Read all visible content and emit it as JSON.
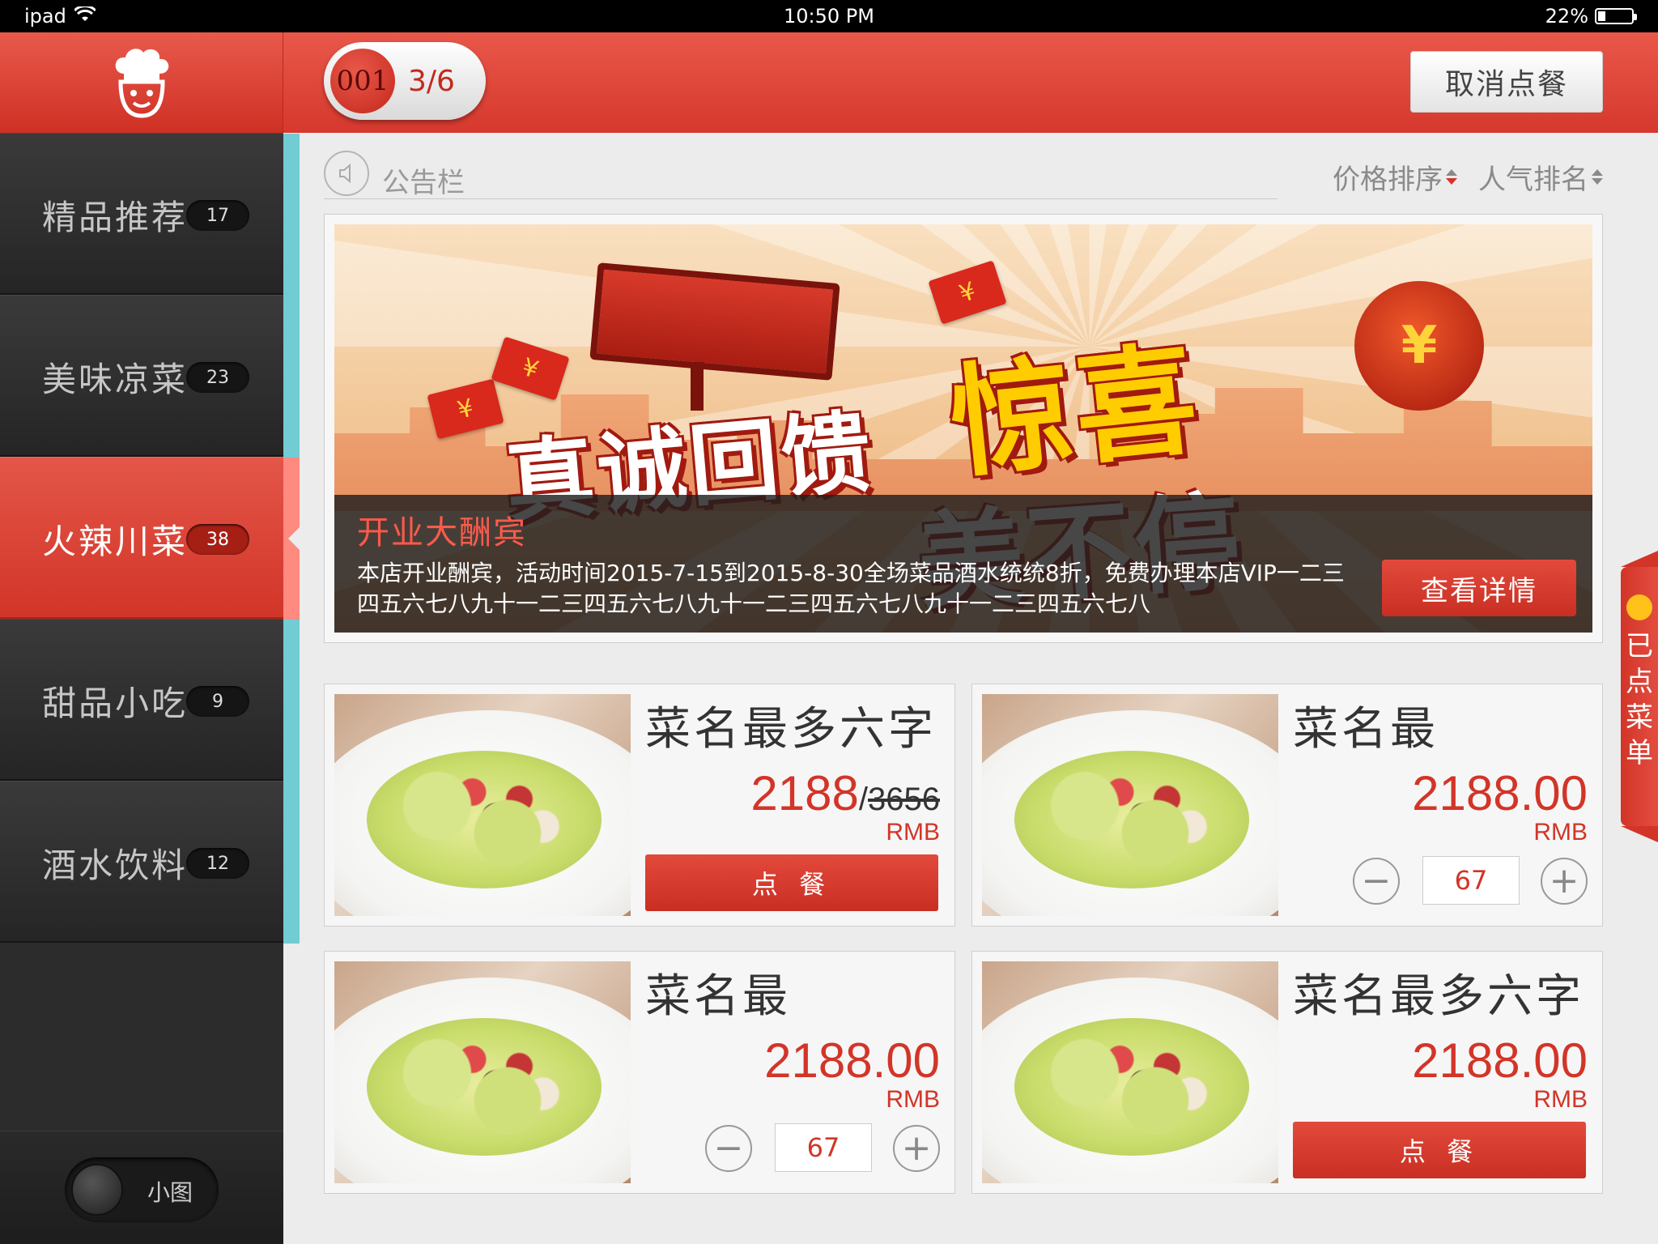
{
  "status_bar": {
    "device": "ipad",
    "time": "10:50 PM",
    "battery": "22%",
    "battery_level": 0.22
  },
  "header": {
    "table_number": "001",
    "table_count": "3/6",
    "cancel_label": "取消点餐"
  },
  "sidebar": {
    "categories": [
      {
        "label": "精品推荐",
        "count": "17"
      },
      {
        "label": "美味凉菜",
        "count": "23"
      },
      {
        "label": "火辣川菜",
        "count": "38"
      },
      {
        "label": "甜品小吃",
        "count": "9"
      },
      {
        "label": "酒水饮料",
        "count": "12"
      }
    ],
    "active_index": 2,
    "toggle_label": "小图"
  },
  "notice": {
    "title": "公告栏"
  },
  "sort": {
    "price": "价格排序",
    "popularity": "人气排名"
  },
  "banner": {
    "promo_line1": "真诚回馈",
    "promo_line2": "惊喜",
    "promo_line3": "美不停",
    "envelope_symbol": "¥",
    "title": "开业大酬宾",
    "description": "本店开业酬宾，活动时间2015-7-15到2015-8-30全场菜品酒水统统8折，免费办理本店VIP一二三四五六七八九十一二三四五六七八九十一二三四五六七八九十一二三四五六七八",
    "details_label": "查看详情"
  },
  "dishes": [
    {
      "name": "菜名最多六字",
      "price": "2188",
      "original_price": "3656",
      "currency": "RMB",
      "action": "点 餐"
    },
    {
      "name": "菜名最",
      "price": "2188.00",
      "currency": "RMB",
      "quantity": "67"
    },
    {
      "name": "菜名最",
      "price": "2188.00",
      "currency": "RMB",
      "quantity": "67"
    },
    {
      "name": "菜名最多六字",
      "price": "2188.00",
      "currency": "RMB",
      "action": "点 餐"
    }
  ],
  "stepper": {
    "minus": "−",
    "plus": "+"
  },
  "drawer": {
    "label": "已点菜单"
  },
  "colors": {
    "brand_red": "#d23528",
    "accent_teal": "#71ccd3",
    "badge_yellow": "#ffc21a"
  }
}
